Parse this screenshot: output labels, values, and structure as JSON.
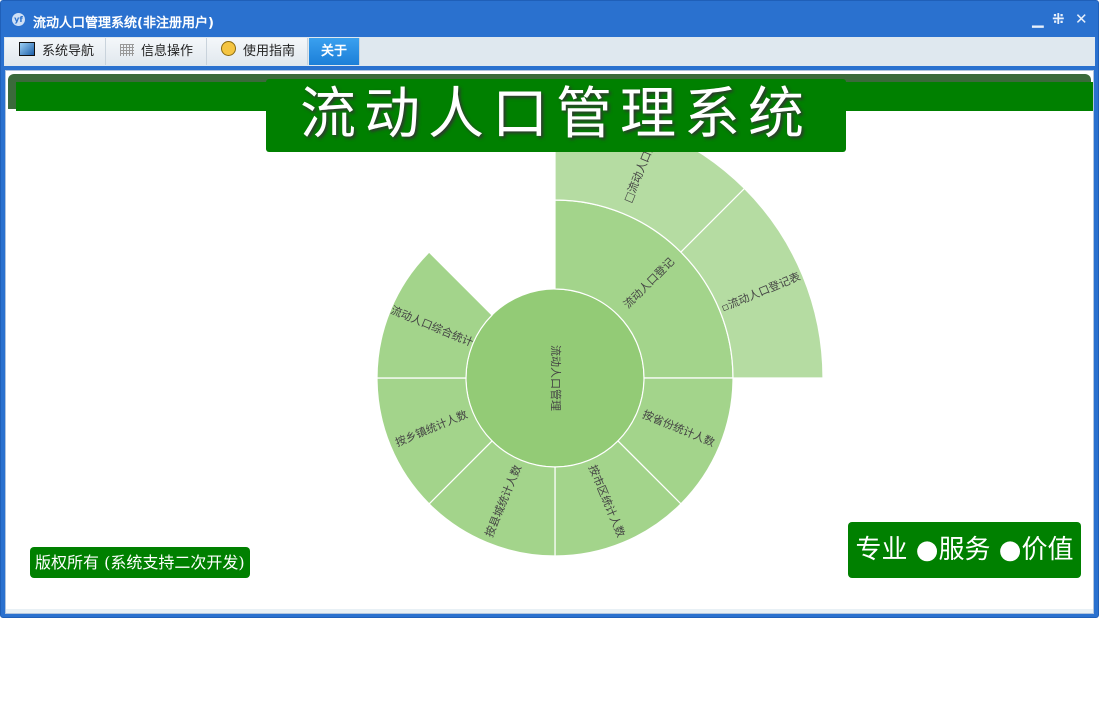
{
  "window": {
    "title": "流动人口管理系统(非注册用户)",
    "logo": "yf"
  },
  "menu": [
    {
      "label": "系统导航",
      "icon": "monitor-icon"
    },
    {
      "label": "信息操作",
      "icon": "grid-icon"
    },
    {
      "label": "使用指南",
      "icon": "help-icon"
    },
    {
      "label": "关于",
      "active": true
    }
  ],
  "header": {
    "title": "流动人口管理系统"
  },
  "footer": {
    "copyright": "版权所有 (系统支持二次开发)",
    "slogan": "专业 ●服务 ●价值"
  },
  "colors": {
    "accent": "#008000",
    "window": "#2a71cf",
    "inner": "#93cb76",
    "mid": "#a3d48b",
    "outer": "#b5dca2"
  },
  "chart_data": {
    "type": "sunburst",
    "root": "流动人口管理",
    "ring1": [
      {
        "label": "流动人口登记",
        "weight": 2
      },
      {
        "label": "按省份统计人数",
        "weight": 1
      },
      {
        "label": "按市区统计人数",
        "weight": 1
      },
      {
        "label": "按县城统计人数",
        "weight": 1
      },
      {
        "label": "按乡镇统计人数",
        "weight": 1
      },
      {
        "label": "流动人口综合统计",
        "weight": 1
      }
    ],
    "ring2": [
      {
        "parent": "流动人口登记",
        "label": "□流动人口登",
        "weight": 1
      },
      {
        "parent": "流动人口登记",
        "label": "▫流动人口登记表",
        "weight": 1
      }
    ]
  }
}
